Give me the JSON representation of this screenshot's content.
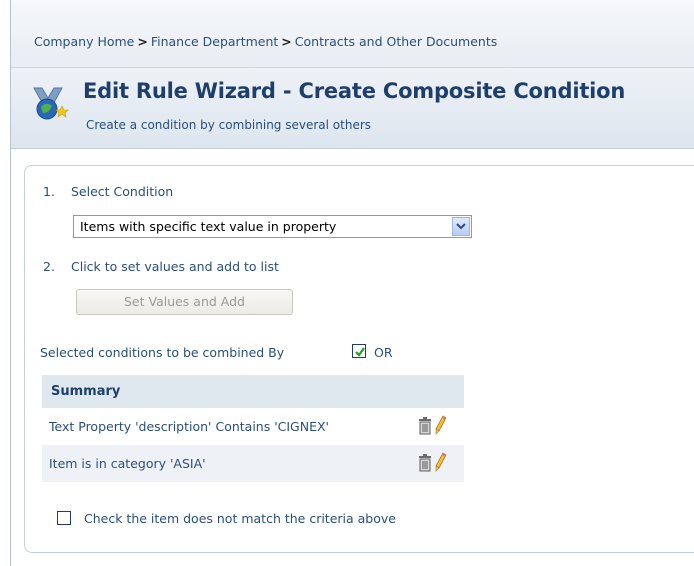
{
  "breadcrumb": {
    "items": [
      "Company Home",
      "Finance Department",
      "Contracts and Other Documents"
    ],
    "separator": ">"
  },
  "header": {
    "title": "Edit Rule Wizard - Create Composite Condition",
    "subtitle": "Create a condition by combining several others",
    "icon": "wizard-icon"
  },
  "steps": {
    "step1_number": "1.",
    "step1_label": "Select Condition",
    "condition_selected": "Items with specific text value in property",
    "step2_number": "2.",
    "step2_label": "Click to set values and add to list",
    "set_values_button": "Set Values and Add"
  },
  "combine": {
    "label": "Selected conditions to be combined By",
    "or_checked": true,
    "or_label": "OR"
  },
  "summary": {
    "header": "Summary",
    "rows": [
      "Text Property 'description' Contains 'CIGNEX'",
      "Item is in category 'ASIA'"
    ]
  },
  "negate": {
    "checked": false,
    "label": "Check the item does not match the criteria above"
  },
  "colors": {
    "text": "#2a4f7a",
    "title": "#1f3f6b",
    "header_bg": "#dde5ee",
    "summary_header_bg": "#dfe7ef",
    "check_green": "#21a121"
  }
}
